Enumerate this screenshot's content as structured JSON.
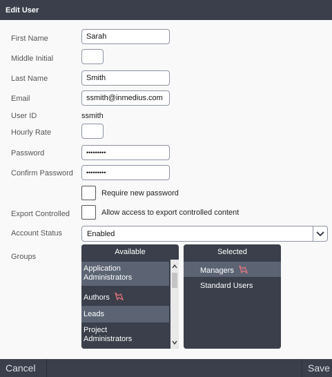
{
  "dialog": {
    "title": "Edit User"
  },
  "form": {
    "first_name": {
      "label": "First Name",
      "value": "Sarah"
    },
    "middle_initial": {
      "label": "Middle Initial",
      "value": ""
    },
    "last_name": {
      "label": "Last Name",
      "value": "Smith"
    },
    "email": {
      "label": "Email",
      "value": "ssmith@inmedius.com"
    },
    "user_id": {
      "label": "User ID",
      "value": "ssmith"
    },
    "hourly_rate": {
      "label": "Hourly Rate",
      "value": ""
    },
    "password": {
      "label": "Password",
      "value": "•••••••••"
    },
    "confirm_password": {
      "label": "Confirm Password",
      "value": "•••••••••"
    },
    "require_new_password": {
      "label": "Require new password",
      "checked": false
    },
    "export_controlled": {
      "label": "Export Controlled",
      "checkbox_label": "Allow access to export controlled content",
      "checked": false
    },
    "account_status": {
      "label": "Account Status",
      "value": "Enabled"
    },
    "groups": {
      "label": "Groups",
      "available": {
        "title": "Available",
        "items": [
          {
            "line1": "Application",
            "line2": "Administrators",
            "icon": null
          },
          {
            "line1": "Authors",
            "line2": "",
            "icon": "pin-icon"
          },
          {
            "line1": "Leads",
            "line2": "",
            "icon": null
          },
          {
            "line1": "Project",
            "line2": "Administrators",
            "icon": null
          }
        ]
      },
      "selected": {
        "title": "Selected",
        "items": [
          {
            "line1": "Managers",
            "icon": "pin-icon"
          },
          {
            "line1": "Standard Users",
            "icon": null
          }
        ]
      }
    }
  },
  "footer": {
    "cancel_label": "Cancel",
    "save_label": "Save"
  },
  "colors": {
    "header": "#3a3f4b",
    "list_light": "#5c6474",
    "pin": "#e2747b"
  }
}
